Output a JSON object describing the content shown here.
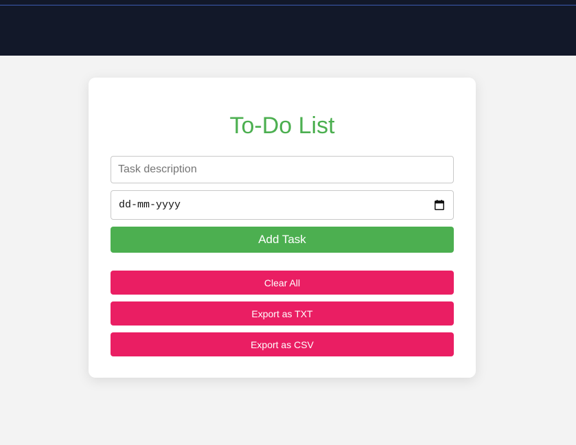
{
  "app": {
    "title": "To-Do List"
  },
  "form": {
    "task_placeholder": "Task description",
    "task_value": "",
    "date_placeholder": "dd-mm-yyyy",
    "add_label": "Add Task"
  },
  "actions": {
    "clear_label": "Clear All",
    "export_txt_label": "Export as TXT",
    "export_csv_label": "Export as CSV"
  },
  "icons": {
    "date_picker": "calendar-icon"
  },
  "colors": {
    "header_bg": "#121829",
    "accent_green": "#4caf50",
    "accent_pink": "#ea1e63",
    "page_bg": "#f3f3f3"
  }
}
